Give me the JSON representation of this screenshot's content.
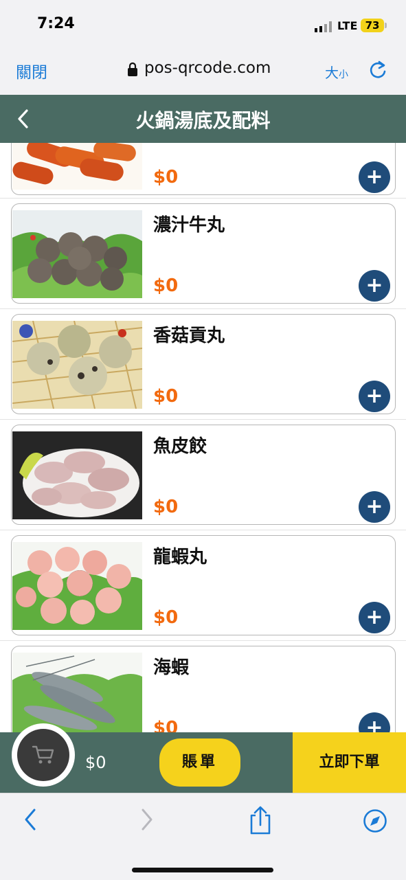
{
  "status": {
    "time": "7:24",
    "network": "LTE",
    "battery": "73"
  },
  "browser": {
    "close_label": "關閉",
    "url": "pos-qrcode.com",
    "size_big": "大",
    "size_small": "小"
  },
  "header": {
    "title": "火鍋湯底及配料"
  },
  "items": [
    {
      "name": "",
      "price": "$0",
      "add_label": "+"
    },
    {
      "name": "濃汁牛丸",
      "price": "$0",
      "add_label": "+"
    },
    {
      "name": "香菇貢丸",
      "price": "$0",
      "add_label": "+"
    },
    {
      "name": "魚皮餃",
      "price": "$0",
      "add_label": "+"
    },
    {
      "name": "龍蝦丸",
      "price": "$0",
      "add_label": "+"
    },
    {
      "name": "海蝦",
      "price": "$0",
      "add_label": "+"
    }
  ],
  "orderbar": {
    "total": "$0",
    "bill_label": "賬單",
    "order_label": "立即下單"
  },
  "colors": {
    "accent": "#4a6b63",
    "price": "#f26a0f",
    "add_button": "#1f4c7a",
    "action_yellow": "#f5d21c",
    "link_blue": "#1b7bd6"
  },
  "icons": [
    "lock-icon",
    "reload-icon",
    "back-chevron-icon",
    "plus-icon",
    "cart-icon",
    "nav-back-icon",
    "nav-forward-icon",
    "share-icon",
    "compass-icon"
  ]
}
